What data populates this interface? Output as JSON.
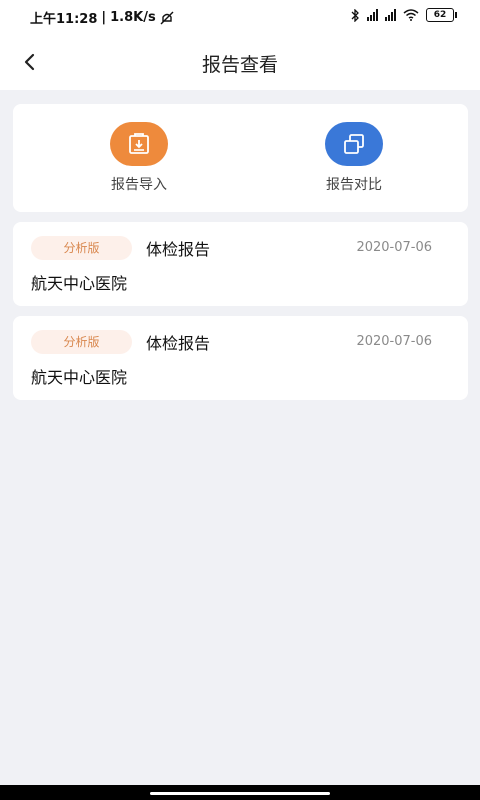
{
  "status": {
    "time": "上午11:28",
    "speed": "1.8K/s",
    "battery": "62"
  },
  "header": {
    "title": "报告查看"
  },
  "actions": [
    {
      "label": "报告导入",
      "icon": "import-icon",
      "color": "#ee8a3c"
    },
    {
      "label": "报告对比",
      "icon": "compare-icon",
      "color": "#3a78d8"
    }
  ],
  "reports": [
    {
      "badge": "分析版",
      "title": "体检报告",
      "date": "2020-07-06",
      "hospital": "航天中心医院"
    },
    {
      "badge": "分析版",
      "title": "体检报告",
      "date": "2020-07-06",
      "hospital": "航天中心医院"
    }
  ]
}
